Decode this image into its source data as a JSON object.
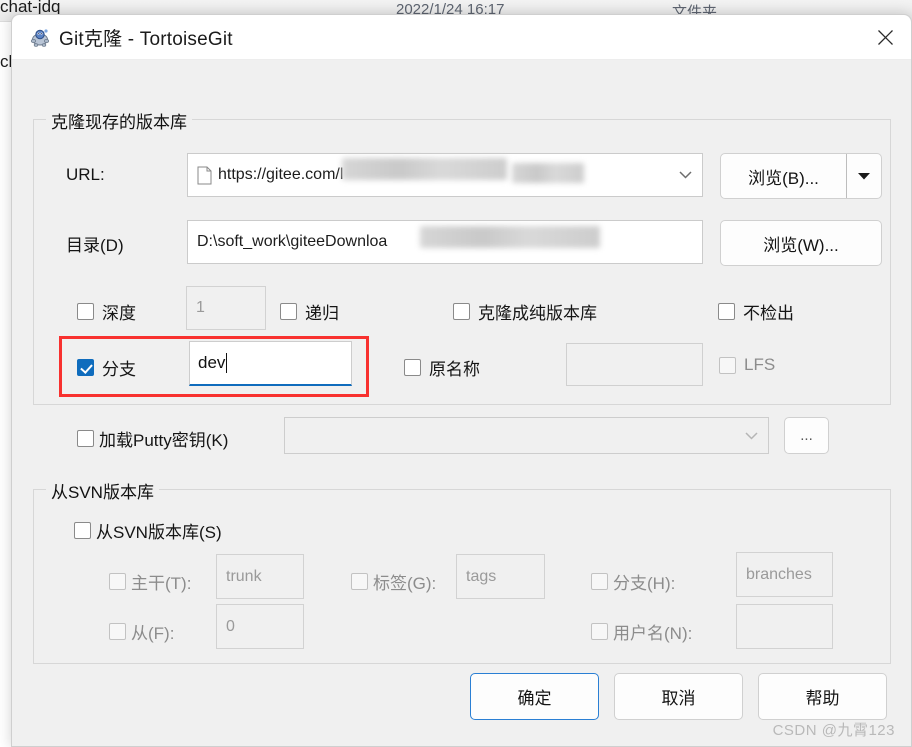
{
  "backdrop": {
    "row1_name": "chat-jdq",
    "row2_name": "ch",
    "date_column": "2022/1/24 16:17",
    "type_column": "文件夹"
  },
  "dialog": {
    "title": "Git克隆 - TortoiseGit",
    "app_icon": "tortoisegit-turtle-icon",
    "close_icon": "close-icon"
  },
  "clone_group": {
    "legend": "克隆现存的版本库",
    "url_label": "URL:",
    "url_value": "https://gitee.com/l",
    "url_icon": "document-icon",
    "url_dropdown_icon": "chevron-down-icon",
    "browse_b_label": "浏览(B)...",
    "browse_b_arrow_icon": "triangle-down-icon",
    "dir_label": "目录(D)",
    "dir_value": "D:\\soft_work\\giteeDownloa",
    "browse_w_label": "浏览(W)...",
    "depth_label": "深度",
    "depth_value": "1",
    "recursive_label": "递归",
    "bare_label": "克隆成纯版本库",
    "no_checkout_label": "不检出",
    "branch_label": "分支",
    "branch_value": "dev",
    "branch_checked": true,
    "origin_name_label": "原名称",
    "origin_name_value": "",
    "lfs_label": "LFS"
  },
  "putty": {
    "label": "加载Putty密钥(K)",
    "value": "",
    "dropdown_icon": "chevron-down-icon",
    "browse_label": "..."
  },
  "svn_group": {
    "legend": "从SVN版本库",
    "enable_label": "从SVN版本库(S)",
    "trunk_label": "主干(T):",
    "trunk_value": "trunk",
    "tags_label": "标签(G):",
    "tags_value": "tags",
    "branch_label": "分支(H):",
    "branch_value": "branches",
    "from_label": "从(F):",
    "from_value": "0",
    "username_label": "用户名(N):",
    "username_value": ""
  },
  "footer": {
    "ok_label": "确定",
    "cancel_label": "取消",
    "help_label": "帮助"
  },
  "watermark": "CSDN @九霄123",
  "colors": {
    "accent": "#0f6cbd",
    "annotation": "#f8312f",
    "dialog_bg": "#f0f0f0"
  }
}
